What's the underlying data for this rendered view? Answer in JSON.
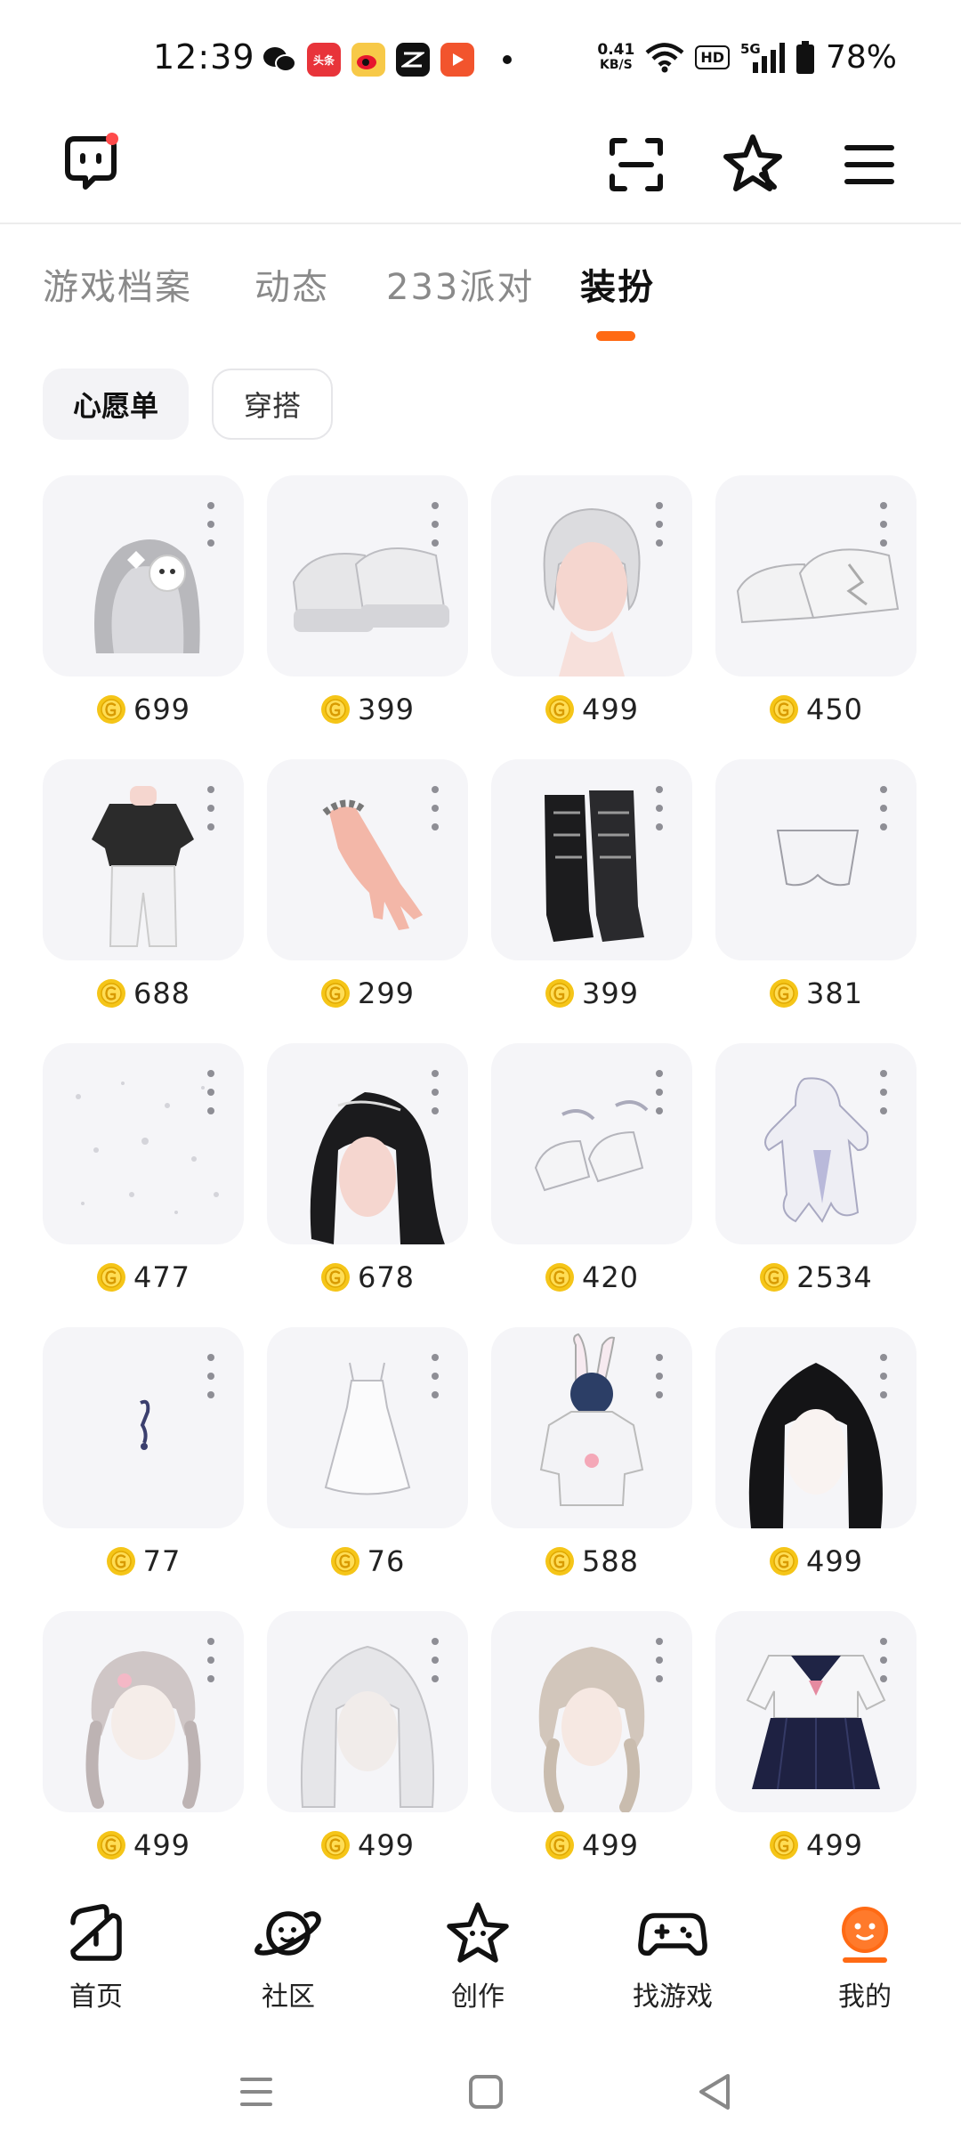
{
  "status": {
    "time": "12:39",
    "net_speed_value": "0.41",
    "net_speed_unit": "KB/S",
    "hd": "HD",
    "signal": "5G",
    "battery": "78%",
    "app_badges": [
      "头条"
    ]
  },
  "tabs": [
    {
      "label": "游戏档案",
      "active": false
    },
    {
      "label": "动态",
      "active": false
    },
    {
      "label": "233派对",
      "active": false
    },
    {
      "label": "装扮",
      "active": true
    }
  ],
  "chips": [
    {
      "label": "心愿单",
      "selected": true
    },
    {
      "label": "穿搭",
      "selected": false
    }
  ],
  "items": [
    {
      "kind": "hair-accessory",
      "price": "699"
    },
    {
      "kind": "sneakers-chunky",
      "price": "399"
    },
    {
      "kind": "hair-short-silver",
      "price": "499"
    },
    {
      "kind": "sneakers-white",
      "price": "450"
    },
    {
      "kind": "outfit-tshirt-pants",
      "price": "688"
    },
    {
      "kind": "hand-bracelet",
      "price": "299"
    },
    {
      "kind": "boots-black",
      "price": "399"
    },
    {
      "kind": "shorts-white",
      "price": "381"
    },
    {
      "kind": "sparkle-effect",
      "price": "477"
    },
    {
      "kind": "hair-long-black",
      "price": "678"
    },
    {
      "kind": "heels-white",
      "price": "420"
    },
    {
      "kind": "ghost-costume",
      "price": "2534"
    },
    {
      "kind": "earring",
      "price": "77"
    },
    {
      "kind": "slip-dress",
      "price": "76"
    },
    {
      "kind": "bunny-hoodie",
      "price": "588"
    },
    {
      "kind": "hair-black-bob",
      "price": "499"
    },
    {
      "kind": "hair-braids-pink",
      "price": "499"
    },
    {
      "kind": "hair-silver-long",
      "price": "499"
    },
    {
      "kind": "hair-braids-beige",
      "price": "499"
    },
    {
      "kind": "sailor-uniform",
      "price": "499"
    }
  ],
  "bottom_nav": [
    {
      "label": "首页",
      "icon": "home-icon",
      "active": false
    },
    {
      "label": "社区",
      "icon": "planet-icon",
      "active": false
    },
    {
      "label": "创作",
      "icon": "star-create-icon",
      "active": false
    },
    {
      "label": "找游戏",
      "icon": "gamepad-icon",
      "active": false
    },
    {
      "label": "我的",
      "icon": "profile-icon",
      "active": true
    }
  ],
  "colors": {
    "accent": "#ff6a14",
    "coin": "#f5c518",
    "coin_inner": "#ffdd55",
    "tile_bg": "#f5f5f8"
  }
}
